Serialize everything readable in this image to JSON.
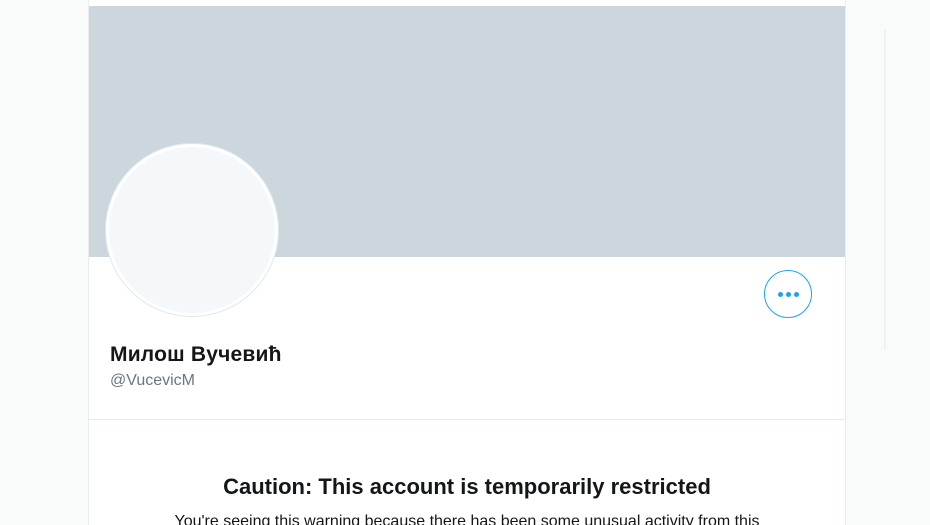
{
  "profile": {
    "display_name": "Милош Вучевић",
    "handle": "@VucevicM",
    "more_button_icon": "more-horizontal-icon"
  },
  "warning": {
    "title": "Caution: This account is temporarily restricted",
    "text": "You're seeing this warning because there has been some unusual activity from this"
  },
  "colors": {
    "banner": "#ccd6dd",
    "accent": "#1da1f2",
    "text_primary": "#14171a",
    "text_secondary": "#657786"
  }
}
